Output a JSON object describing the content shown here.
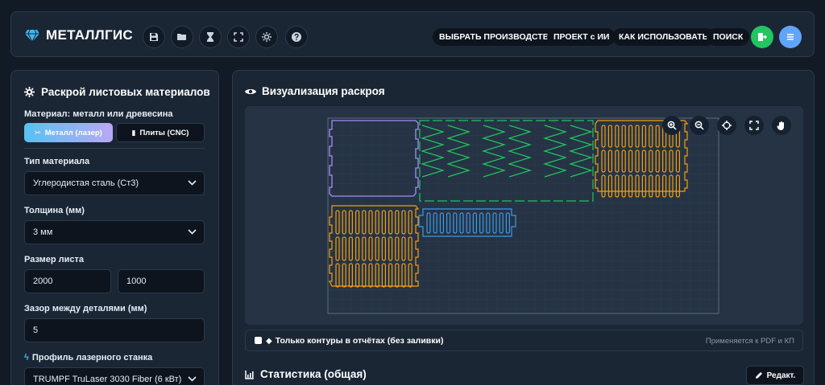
{
  "header": {
    "app_name": "МЕТАЛЛГИС",
    "nav": [
      "ВЫБРАТЬ ПРОИЗВОДСТВО",
      "ПРОЕКТ с ИИ",
      "КАК ИСПОЛЬЗОВАТЬ",
      "ПОИСК"
    ],
    "toolbar_icons": [
      "save-icon",
      "folder-open-icon",
      "hourglass-icon",
      "expand-icon",
      "settings-icon",
      "help-icon"
    ],
    "export_icon": "export-icon",
    "menu_icon": "menu-icon",
    "colors": {
      "export": "#22c55e",
      "menu": "#60a5fa"
    }
  },
  "left_panel": {
    "title": "Раскрой листовых материалов",
    "material_label": "Материал: металл или древесина",
    "material_options": [
      "Металл (лазер)",
      "Плиты (CNC)"
    ],
    "material_selected": "Металл (лазер)",
    "type_label": "Тип материала",
    "type_value": "Углеродистая сталь (Ст3)",
    "thickness_label": "Толщина (мм)",
    "thickness_value": "3 мм",
    "sheet_label": "Размер листа",
    "sheet_width": "2000",
    "sheet_height": "1000",
    "gap_label": "Зазор между деталями (мм)",
    "gap_value": "5",
    "laser_label": "Профиль лазерного станка",
    "laser_value": "TRUMPF TruLaser 3030 Fiber (6 кВт)"
  },
  "right_panel": {
    "title": "Визуализация раскроя",
    "tools": [
      "zoom-in-icon",
      "zoom-out-icon",
      "crosshair-icon",
      "fullscreen-icon",
      "pan-hand-icon"
    ],
    "contour_label": "Только контуры в отчётах (без заливки)",
    "contour_checked": false,
    "contour_hint": "Применяется к PDF и КП",
    "stats_title": "Статистика (общая)",
    "edit_label": "Редакт."
  },
  "canvas_colors": {
    "purple": "#a78bfa",
    "green": "#22c55e",
    "orange": "#f59e0b",
    "blue": "#3b9be8",
    "sheet": "#5b6b80",
    "grid": "#2e3d52"
  }
}
